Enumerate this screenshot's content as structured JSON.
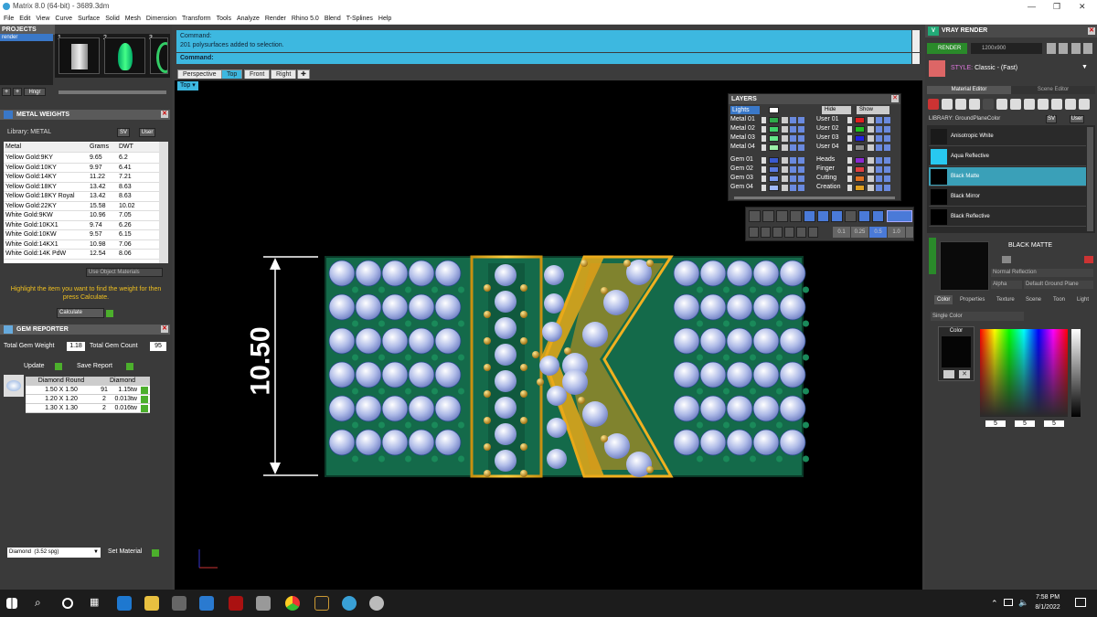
{
  "app": {
    "title": "Matrix 8.0 (64-bit) - 3689.3dm"
  },
  "menu": [
    "File",
    "Edit",
    "View",
    "Curve",
    "Surface",
    "Solid",
    "Mesh",
    "Dimension",
    "Transform",
    "Tools",
    "Analyze",
    "Render",
    "Rhino 5.0",
    "Blend",
    "T-Splines",
    "Help"
  ],
  "projects": {
    "header": "PROJECTS",
    "item": "render",
    "nums": [
      "1",
      "2",
      "3"
    ],
    "hinge": "Hngr"
  },
  "metal_weights": {
    "header": "METAL WEIGHTS",
    "library_label": "Library: METAL",
    "sv": "SV",
    "user": "User",
    "cols": [
      "Metal",
      "Grams",
      "DWT"
    ],
    "rows": [
      [
        "Yellow Gold:9KY",
        "9.65",
        "6.2"
      ],
      [
        "Yellow Gold:10KY",
        "9.97",
        "6.41"
      ],
      [
        "Yellow Gold:14KY",
        "11.22",
        "7.21"
      ],
      [
        "Yellow Gold:18KY",
        "13.42",
        "8.63"
      ],
      [
        "Yellow Gold:18KY Royal",
        "13.42",
        "8.63"
      ],
      [
        "Yellow Gold:22KY",
        "15.58",
        "10.02"
      ],
      [
        "White Gold:9KW",
        "10.96",
        "7.05"
      ],
      [
        "White Gold:10KX1",
        "9.74",
        "6.26"
      ],
      [
        "White Gold:10KW",
        "9.57",
        "6.15"
      ],
      [
        "White Gold:14KX1",
        "10.98",
        "7.06"
      ],
      [
        "White Gold:14K PdW",
        "12.54",
        "8.06"
      ]
    ],
    "use_obj_mat": "Use Object Materials",
    "hint": "Highlight the item you want to find the weight for then press Calculate.",
    "calculate": "Calculate"
  },
  "gem_reporter": {
    "header": "GEM REPORTER",
    "total_weight_label": "Total Gem Weight",
    "total_weight": "1.18",
    "total_count_label": "Total Gem Count",
    "total_count": "95",
    "update": "Update",
    "save_report": "Save Report",
    "col1": "Diamond Round",
    "col2": "Diamond",
    "rows": [
      [
        "1.50 X 1.50",
        "91",
        "1.15tw"
      ],
      [
        "1.20 X 1.20",
        "2",
        "0.013tw"
      ],
      [
        "1.30 X 1.30",
        "2",
        "0.016tw"
      ]
    ],
    "material": "Diamond",
    "spg": "(3.52 spg)",
    "set_material": "Set Material"
  },
  "command": {
    "line1": "Command:",
    "line2": "201 polysurfaces added to selection.",
    "prompt": "Command:"
  },
  "viewtabs": [
    "Perspective",
    "Top",
    "Front",
    "Right"
  ],
  "viewport": {
    "label": "Top",
    "dimension": "10.50"
  },
  "layers": {
    "header": "LAYERS",
    "lights": "Lights",
    "hide": "Hide",
    "show": "Show",
    "left": [
      {
        "n": "Metal 01",
        "c": "#2faa4a"
      },
      {
        "n": "Metal 02",
        "c": "#3fd26a"
      },
      {
        "n": "Metal 03",
        "c": "#66e88a"
      },
      {
        "n": "Metal 04",
        "c": "#9cf0a8"
      },
      {
        "n": "Gem 01",
        "c": "#3a5ad0"
      },
      {
        "n": "Gem 02",
        "c": "#5a7ae0"
      },
      {
        "n": "Gem 03",
        "c": "#7a9af0"
      },
      {
        "n": "Gem 04",
        "c": "#a0b8f8"
      }
    ],
    "right": [
      {
        "n": "User 01",
        "c": "#e02020"
      },
      {
        "n": "User 02",
        "c": "#20c020"
      },
      {
        "n": "User 03",
        "c": "#2020e0"
      },
      {
        "n": "User 04",
        "c": "#888888"
      },
      {
        "n": "Heads",
        "c": "#8a2ad0"
      },
      {
        "n": "Finger",
        "c": "#e04040"
      },
      {
        "n": "Cutting",
        "c": "#e07020"
      },
      {
        "n": "Creation",
        "c": "#e0a020"
      }
    ]
  },
  "snapbar": {
    "values": [
      "0.1",
      "0.25",
      "0.5",
      "1.0"
    ]
  },
  "vray": {
    "header": "VRAY RENDER",
    "render": "RENDER",
    "res": "1200x900",
    "style_label": "STYLE:",
    "style": "Classic - (Fast)",
    "tabs": [
      "Material Editor",
      "Scene Editor"
    ],
    "library": "LIBRARY: GroundPlaneColor",
    "sv": "SV",
    "user": "User",
    "materials": [
      {
        "n": "Anisotropic White",
        "c": "#1a1a1a"
      },
      {
        "n": "Aqua Reflective",
        "c": "#28c8f0"
      },
      {
        "n": "Black Matte",
        "c": "#000000"
      },
      {
        "n": "Black Mirror",
        "c": "#000000"
      },
      {
        "n": "Black Reflective",
        "c": "#000000"
      }
    ],
    "selected_name": "BLACK MATTE",
    "reflection": "Normal Reflection",
    "alpha": "Alpha",
    "ground": "Default Ground Plane",
    "subtabs": [
      "Color",
      "Properties",
      "Texture",
      "Scene",
      "Toon",
      "Light"
    ],
    "color_mode": "Single Color",
    "color_label": "Color",
    "rgb": [
      "5",
      "5",
      "5"
    ]
  },
  "taskbar": {
    "time": "7:58 PM",
    "date": "8/1/2022"
  }
}
